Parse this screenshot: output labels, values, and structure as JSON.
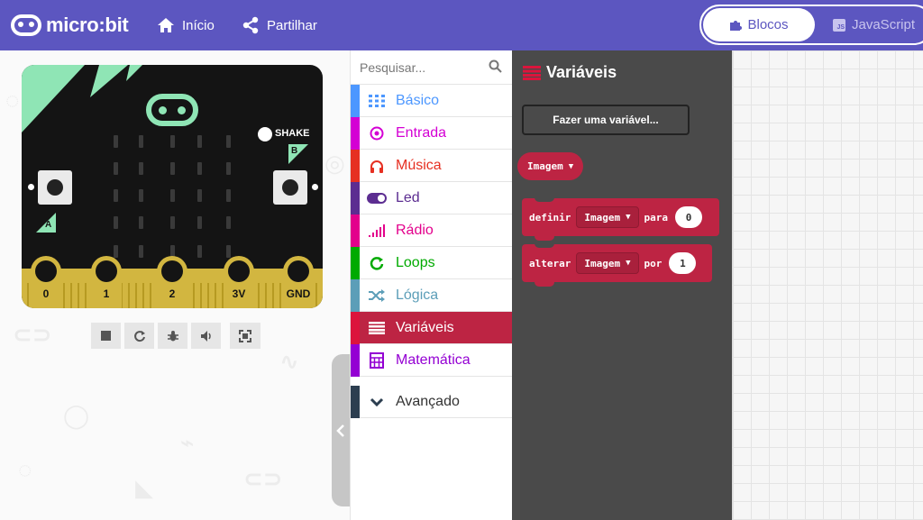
{
  "app": {
    "logo_text": "micro:bit",
    "nav": {
      "home_label": "Início",
      "share_label": "Partilhar"
    },
    "mode_tabs": {
      "blocks_label": "Blocos",
      "js_label": "JavaScript",
      "js_badge": "JS"
    }
  },
  "simulator": {
    "shake_label": "SHAKE",
    "button_a_label": "A",
    "button_b_label": "B",
    "pins": [
      "0",
      "1",
      "2",
      "3V",
      "GND"
    ],
    "controls": [
      "stop-icon",
      "restart-icon",
      "debug-icon",
      "mute-icon",
      "fullscreen-icon"
    ]
  },
  "toolbox": {
    "search_placeholder": "Pesquisar...",
    "categories": [
      {
        "label": "Básico",
        "color": "#4c97ff",
        "icon": "grid-icon"
      },
      {
        "label": "Entrada",
        "color": "#d400d4",
        "icon": "target-icon"
      },
      {
        "label": "Música",
        "color": "#e63022",
        "icon": "headphones-icon"
      },
      {
        "label": "Led",
        "color": "#5c2d91",
        "icon": "toggle-icon"
      },
      {
        "label": "Rádio",
        "color": "#e3008c",
        "icon": "signal-icon"
      },
      {
        "label": "Loops",
        "color": "#00aa00",
        "icon": "refresh-icon"
      },
      {
        "label": "Lógica",
        "color": "#5c9eb8",
        "icon": "shuffle-icon"
      },
      {
        "label": "Variáveis",
        "color": "#dc143c",
        "icon": "list-icon",
        "selected": true
      },
      {
        "label": "Matemática",
        "color": "#9400d3",
        "icon": "calculator-icon"
      },
      {
        "label": "Avançado",
        "color": "#2c3e50",
        "icon": "chevron-down-icon"
      }
    ]
  },
  "flyout": {
    "title": "Variáveis",
    "make_variable_label": "Fazer uma variável...",
    "variable_name": "Imagem",
    "set_block": {
      "keyword": "definir",
      "variable": "Imagem",
      "to": "para",
      "value": "0"
    },
    "change_block": {
      "keyword": "alterar",
      "variable": "Imagem",
      "by": "por",
      "value": "1"
    },
    "block_color": "#bd2443"
  }
}
